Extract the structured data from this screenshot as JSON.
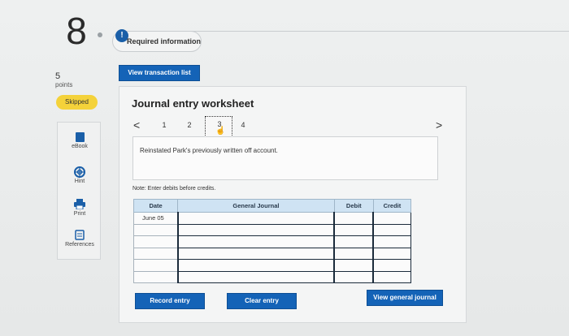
{
  "question": {
    "number": "8",
    "points_value": "5",
    "points_label": "points",
    "status": "Skipped"
  },
  "header": {
    "required_info": "Required information",
    "info_icon": "!"
  },
  "sidebar": {
    "items": [
      {
        "label": "eBook",
        "icon": "book-icon"
      },
      {
        "label": "Hint",
        "icon": "life-ring-icon"
      },
      {
        "label": "Print",
        "icon": "printer-icon"
      },
      {
        "label": "References",
        "icon": "document-icon"
      }
    ]
  },
  "buttons": {
    "view_transaction_list": "View transaction list",
    "record_entry": "Record entry",
    "clear_entry": "Clear entry",
    "view_general_journal": "View general journal"
  },
  "worksheet": {
    "title": "Journal entry worksheet",
    "steps": [
      "1",
      "2",
      "3",
      "4"
    ],
    "active_step": "3",
    "prev": "<",
    "next": ">",
    "description": "Reinstated Park's previously written off account.",
    "note": "Note: Enter debits before credits."
  },
  "table": {
    "headers": {
      "date": "Date",
      "general_journal": "General Journal",
      "debit": "Debit",
      "credit": "Credit"
    },
    "rows": [
      {
        "date": "June 05",
        "general_journal": "",
        "debit": "",
        "credit": ""
      },
      {
        "date": "",
        "general_journal": "",
        "debit": "",
        "credit": ""
      },
      {
        "date": "",
        "general_journal": "",
        "debit": "",
        "credit": ""
      },
      {
        "date": "",
        "general_journal": "",
        "debit": "",
        "credit": ""
      },
      {
        "date": "",
        "general_journal": "",
        "debit": "",
        "credit": ""
      },
      {
        "date": "",
        "general_journal": "",
        "debit": "",
        "credit": ""
      }
    ]
  },
  "colors": {
    "primary_button": "#1463b7",
    "skipped_badge": "#f4d23a",
    "table_header": "#cfe3f3"
  }
}
